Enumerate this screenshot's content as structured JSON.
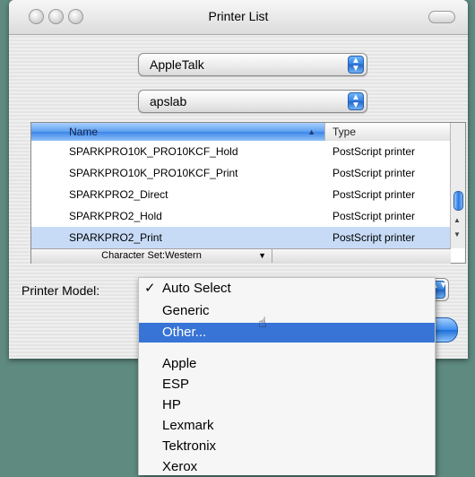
{
  "window": {
    "title": "Printer List"
  },
  "connection_popup": {
    "value": "AppleTalk"
  },
  "zone_popup": {
    "value": "apslab"
  },
  "printer_table": {
    "columns": [
      "Name",
      "Type"
    ],
    "rows": [
      {
        "name": "SPARKPRO10K_PRO10KCF_Hold",
        "type": "PostScript printer",
        "selected": false
      },
      {
        "name": "SPARKPRO10K_PRO10KCF_Print",
        "type": "PostScript printer",
        "selected": false
      },
      {
        "name": "SPARKPRO2_Direct",
        "type": "PostScript printer",
        "selected": false
      },
      {
        "name": "SPARKPRO2_Hold",
        "type": "PostScript printer",
        "selected": false
      },
      {
        "name": "SPARKPRO2_Print",
        "type": "PostScript printer",
        "selected": true
      }
    ],
    "character_set": "Character Set:Western"
  },
  "printer_model": {
    "label": "Printer Model:",
    "menu": [
      {
        "label": "Auto Select",
        "checked": true,
        "highlighted": false
      },
      {
        "label": "Generic",
        "checked": false,
        "highlighted": false
      },
      {
        "label": "Other...",
        "checked": false,
        "highlighted": true
      },
      {
        "label": "Apple",
        "checked": false,
        "highlighted": false
      },
      {
        "label": "ESP",
        "checked": false,
        "highlighted": false
      },
      {
        "label": "HP",
        "checked": false,
        "highlighted": false
      },
      {
        "label": "Lexmark",
        "checked": false,
        "highlighted": false
      },
      {
        "label": "Tektronix",
        "checked": false,
        "highlighted": false
      },
      {
        "label": "Xerox",
        "checked": false,
        "highlighted": false
      }
    ],
    "check_glyph": "✓"
  },
  "colors": {
    "desktop": "#5e8a80",
    "highlight": "#3874d6",
    "selected_row": "#c7dbf7"
  }
}
